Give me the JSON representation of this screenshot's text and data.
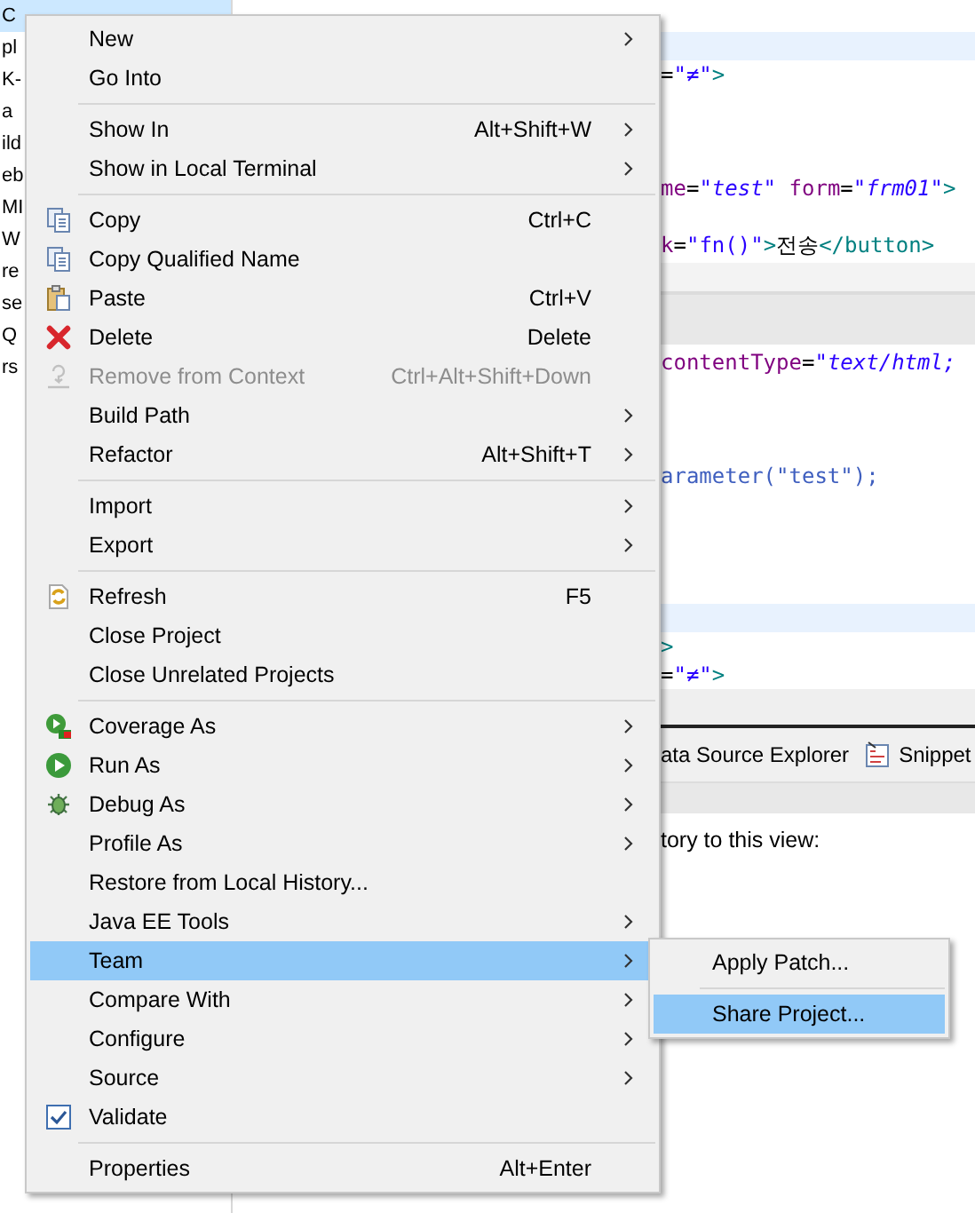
{
  "project_tree": {
    "items": [
      {
        "label": "C",
        "selected": true
      },
      {
        "label": "pl",
        "selected": false
      },
      {
        "label": "K-",
        "selected": false
      },
      {
        "label": "a",
        "selected": false
      },
      {
        "label": "ild",
        "selected": false
      },
      {
        "label": "eb",
        "selected": false
      },
      {
        "label": "MI",
        "selected": false
      },
      {
        "label": "W",
        "selected": false
      },
      {
        "label": "re",
        "selected": false
      },
      {
        "label": "se",
        "selected": false
      },
      {
        "label": "Q",
        "selected": false
      },
      {
        "label": "rs",
        "selected": false
      }
    ]
  },
  "editor_top": {
    "lines": [
      {
        "kind": "blank"
      },
      {
        "kind": "current"
      },
      {
        "kind": "code",
        "segments": [
          {
            "kind": "plain",
            "text": "="
          },
          {
            "kind": "value",
            "text": "\"≠\""
          },
          {
            "kind": "tag",
            "text": ">"
          }
        ]
      },
      {
        "kind": "blank"
      },
      {
        "kind": "blank"
      },
      {
        "kind": "blank"
      },
      {
        "kind": "code",
        "segments": [
          {
            "kind": "attr",
            "text": "me"
          },
          {
            "kind": "plain",
            "text": "="
          },
          {
            "kind": "value",
            "text": "\"test\" "
          },
          {
            "kind": "attr",
            "text": "form"
          },
          {
            "kind": "plain",
            "text": "="
          },
          {
            "kind": "value",
            "text": "\"frm01\""
          },
          {
            "kind": "tag",
            "text": ">"
          }
        ]
      },
      {
        "kind": "blank"
      },
      {
        "kind": "code",
        "segments": [
          {
            "kind": "attr",
            "text": "k"
          },
          {
            "kind": "plain",
            "text": "="
          },
          {
            "kind": "string",
            "text": "\"fn()\""
          },
          {
            "kind": "tag",
            "text": ">"
          },
          {
            "kind": "plain",
            "text": "전송"
          },
          {
            "kind": "tag",
            "text": "</button>"
          }
        ]
      }
    ]
  },
  "editor_bottom": {
    "lines": [
      {
        "kind": "code",
        "segments": [
          {
            "kind": "attr",
            "text": "contentType"
          },
          {
            "kind": "plain",
            "text": "="
          },
          {
            "kind": "value",
            "text": "\"text/html;"
          }
        ]
      },
      {
        "kind": "blank"
      },
      {
        "kind": "blank"
      },
      {
        "kind": "blank"
      },
      {
        "kind": "code",
        "segments": [
          {
            "kind": "method",
            "text": "arameter(\"test\");"
          }
        ]
      },
      {
        "kind": "blank"
      },
      {
        "kind": "blank"
      },
      {
        "kind": "blank"
      },
      {
        "kind": "blank"
      },
      {
        "kind": "current"
      },
      {
        "kind": "code",
        "segments": [
          {
            "kind": "tag",
            "text": ">"
          }
        ]
      },
      {
        "kind": "code",
        "segments": [
          {
            "kind": "plain",
            "text": "="
          },
          {
            "kind": "value",
            "text": "\"≠\""
          },
          {
            "kind": "tag",
            "text": ">"
          }
        ]
      }
    ]
  },
  "views": {
    "tabs": [
      {
        "kind": "plain",
        "label": "ata Source Explorer"
      },
      {
        "kind": "snippets",
        "label": "Snippet"
      }
    ],
    "message": "tory to this view:"
  },
  "context_menu": {
    "items": [
      {
        "kind": "item",
        "label": "New",
        "submenu": true,
        "disabled": false,
        "selected": false
      },
      {
        "kind": "item",
        "label": "Go Into",
        "submenu": false,
        "disabled": false,
        "selected": false
      },
      {
        "kind": "separator"
      },
      {
        "kind": "item",
        "label": "Show In",
        "shortcut": "Alt+Shift+W",
        "submenu": true,
        "disabled": false,
        "selected": false
      },
      {
        "kind": "item",
        "label": "Show in Local Terminal",
        "submenu": true,
        "disabled": false,
        "selected": false
      },
      {
        "kind": "separator"
      },
      {
        "kind": "copy",
        "label": "Copy",
        "shortcut": "Ctrl+C",
        "submenu": false,
        "disabled": false,
        "selected": false
      },
      {
        "kind": "copy",
        "label": "Copy Qualified Name",
        "submenu": false,
        "disabled": false,
        "selected": false
      },
      {
        "kind": "paste",
        "label": "Paste",
        "shortcut": "Ctrl+V",
        "submenu": false,
        "disabled": false,
        "selected": false
      },
      {
        "kind": "delete",
        "label": "Delete",
        "shortcut": "Delete",
        "submenu": false,
        "disabled": false,
        "selected": false
      },
      {
        "kind": "remove",
        "label": "Remove from Context",
        "shortcut": "Ctrl+Alt+Shift+Down",
        "submenu": false,
        "disabled": true,
        "selected": false
      },
      {
        "kind": "item",
        "label": "Build Path",
        "submenu": true,
        "disabled": false,
        "selected": false
      },
      {
        "kind": "item",
        "label": "Refactor",
        "shortcut": "Alt+Shift+T",
        "submenu": true,
        "disabled": false,
        "selected": false
      },
      {
        "kind": "separator"
      },
      {
        "kind": "item",
        "label": "Import",
        "submenu": true,
        "disabled": false,
        "selected": false
      },
      {
        "kind": "item",
        "label": "Export",
        "submenu": true,
        "disabled": false,
        "selected": false
      },
      {
        "kind": "separator"
      },
      {
        "kind": "refresh",
        "label": "Refresh",
        "shortcut": "F5",
        "submenu": false,
        "disabled": false,
        "selected": false
      },
      {
        "kind": "item",
        "label": "Close Project",
        "submenu": false,
        "disabled": false,
        "selected": false
      },
      {
        "kind": "item",
        "label": "Close Unrelated Projects",
        "submenu": false,
        "disabled": false,
        "selected": false
      },
      {
        "kind": "separator"
      },
      {
        "kind": "coverage",
        "label": "Coverage As",
        "submenu": true,
        "disabled": false,
        "selected": false
      },
      {
        "kind": "run",
        "label": "Run As",
        "submenu": true,
        "disabled": false,
        "selected": false
      },
      {
        "kind": "debug",
        "label": "Debug As",
        "submenu": true,
        "disabled": false,
        "selected": false
      },
      {
        "kind": "item",
        "label": "Profile As",
        "submenu": true,
        "disabled": false,
        "selected": false
      },
      {
        "kind": "item",
        "label": "Restore from Local History...",
        "submenu": false,
        "disabled": false,
        "selected": false
      },
      {
        "kind": "item",
        "label": "Java EE Tools",
        "submenu": true,
        "disabled": false,
        "selected": false
      },
      {
        "kind": "item",
        "label": "Team",
        "submenu": true,
        "disabled": false,
        "selected": true
      },
      {
        "kind": "item",
        "label": "Compare With",
        "submenu": true,
        "disabled": false,
        "selected": false
      },
      {
        "kind": "item",
        "label": "Configure",
        "submenu": true,
        "disabled": false,
        "selected": false
      },
      {
        "kind": "item",
        "label": "Source",
        "submenu": true,
        "disabled": false,
        "selected": false
      },
      {
        "kind": "check",
        "label": "Validate",
        "checked": true,
        "submenu": false,
        "disabled": false,
        "selected": false
      },
      {
        "kind": "separator"
      },
      {
        "kind": "item",
        "label": "Properties",
        "shortcut": "Alt+Enter",
        "submenu": false,
        "disabled": false,
        "selected": false
      }
    ]
  },
  "team_submenu": {
    "items": [
      {
        "kind": "item",
        "label": "Apply Patch...",
        "selected": false
      },
      {
        "kind": "separator"
      },
      {
        "kind": "item",
        "label": "Share Project...",
        "selected": true
      }
    ]
  }
}
